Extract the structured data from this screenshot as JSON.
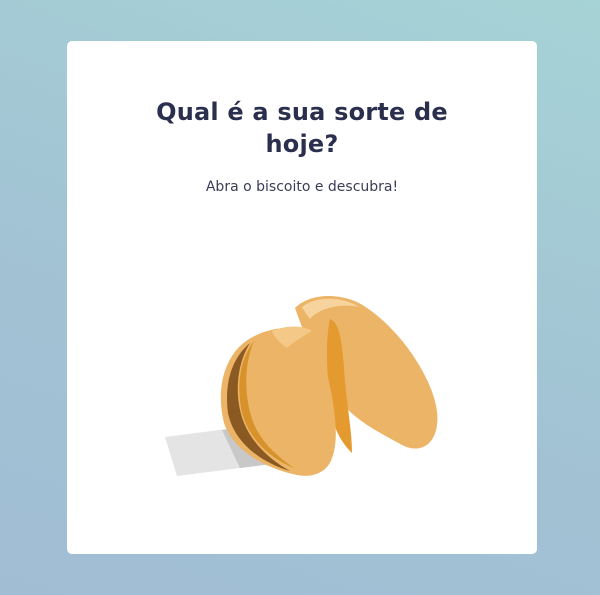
{
  "card": {
    "title": "Qual é a sua sorte de hoje?",
    "subtitle": "Abra o biscoito e descubra!"
  },
  "cookie": {
    "icon": "fortune-cookie-icon",
    "colors": {
      "light": "#ecb466",
      "dark": "#e59a30",
      "shadow": "#8a5a22",
      "highlight": "#f7d49e",
      "paper": "#e4e4e4",
      "paper_shadow": "#c8c8c8"
    }
  }
}
